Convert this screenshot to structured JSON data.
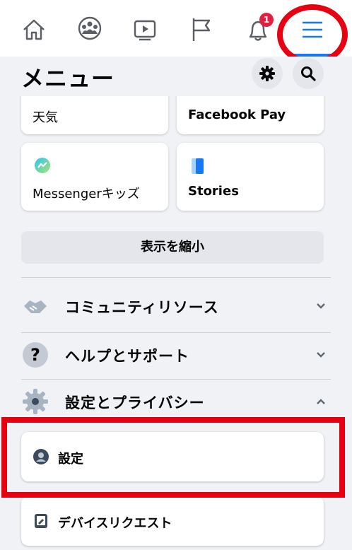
{
  "nav": {
    "tabs": [
      {
        "name": "home"
      },
      {
        "name": "groups"
      },
      {
        "name": "watch"
      },
      {
        "name": "pages"
      },
      {
        "name": "notifications",
        "badge": "1"
      },
      {
        "name": "menu",
        "active": true
      }
    ]
  },
  "menu": {
    "title": "メニュー",
    "shortcuts": [
      {
        "label": "天気"
      },
      {
        "label": "Facebook Pay"
      },
      {
        "label": "Messengerキッズ"
      },
      {
        "label": "Stories"
      }
    ],
    "collapse_label": "表示を縮小",
    "sections": [
      {
        "label": "コミュニティリソース",
        "chevron": "down",
        "icon": "handshake-icon"
      },
      {
        "label": "ヘルプとサポート",
        "chevron": "down",
        "icon": "question-icon"
      },
      {
        "label": "設定とプライバシー",
        "chevron": "up",
        "icon": "gear-icon"
      }
    ],
    "settings_items": [
      {
        "label": "設定",
        "icon": "account-icon"
      },
      {
        "label": "デバイスリクエスト",
        "icon": "device-icon"
      }
    ]
  },
  "colors": {
    "accent": "#1877f2",
    "annotation_red": "#e60012",
    "badge_red": "#e41e3f",
    "background": "#f0f2f5"
  }
}
